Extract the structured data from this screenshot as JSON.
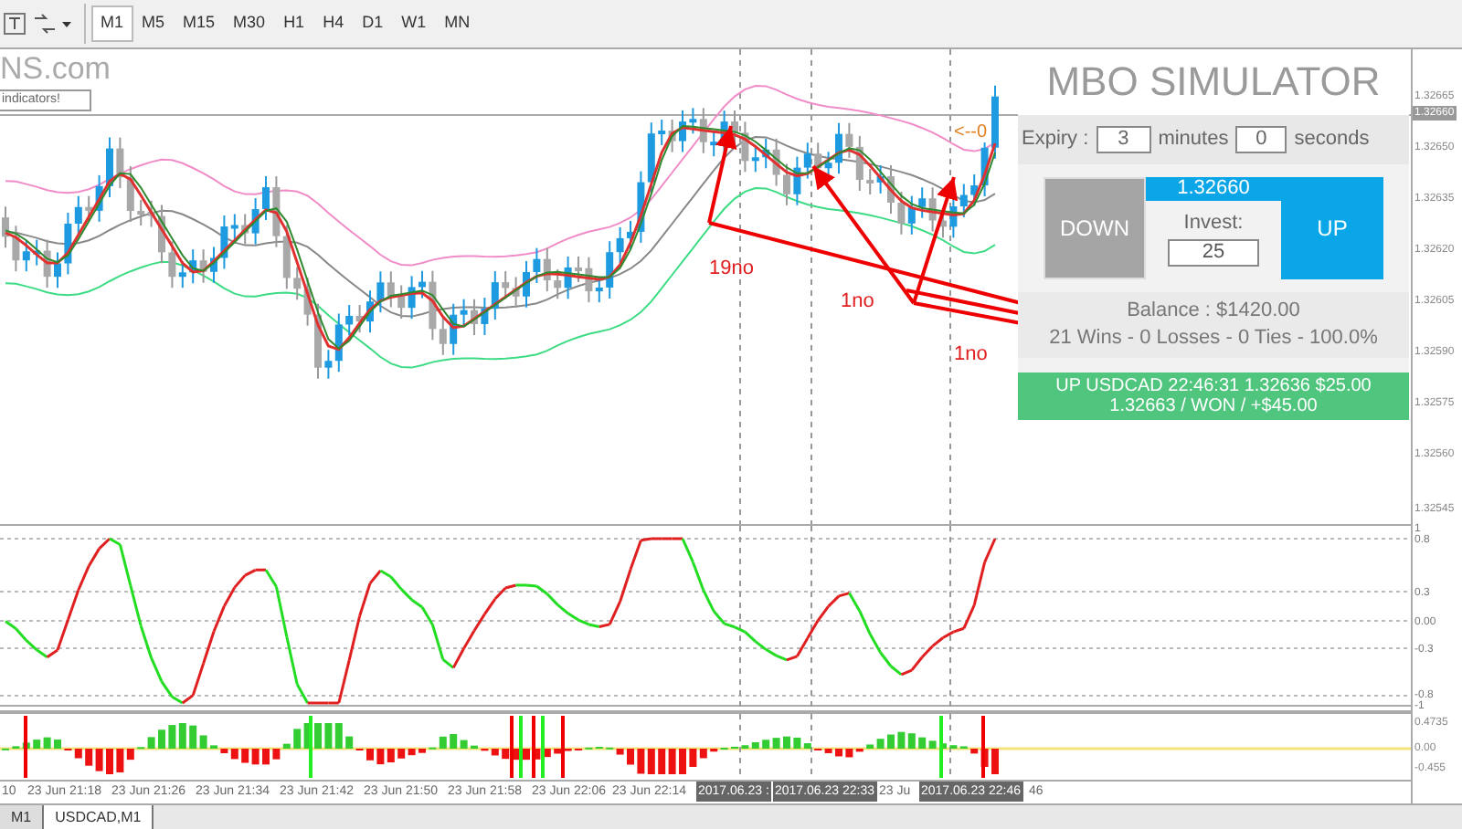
{
  "toolbar": {
    "timeframes": [
      {
        "label": "M1",
        "selected": true
      },
      {
        "label": "M5",
        "selected": false
      },
      {
        "label": "M15",
        "selected": false
      },
      {
        "label": "M30",
        "selected": false
      },
      {
        "label": "H1",
        "selected": false
      },
      {
        "label": "H4",
        "selected": false
      },
      {
        "label": "D1",
        "selected": false
      },
      {
        "label": "W1",
        "selected": false
      },
      {
        "label": "MN",
        "selected": false
      }
    ]
  },
  "chart": {
    "logo_text": "NS.com",
    "banner_text": "indicators!",
    "price_tag": "<--0",
    "annotations": [
      {
        "text": "19no"
      },
      {
        "text": "1no"
      },
      {
        "text": "1no"
      }
    ],
    "price_axis": [
      {
        "label": "1.32665",
        "current": false
      },
      {
        "label": "1.32660",
        "current": true
      },
      {
        "label": "1.32650",
        "current": false
      },
      {
        "label": "1.32635",
        "current": false
      },
      {
        "label": "1.32620",
        "current": false
      },
      {
        "label": "1.32605",
        "current": false
      },
      {
        "label": "1.32590",
        "current": false
      },
      {
        "label": "1.32575",
        "current": false
      },
      {
        "label": "1.32560",
        "current": false
      },
      {
        "label": "1.32545",
        "current": false
      }
    ]
  },
  "simulator": {
    "title": "MBO SIMULATOR",
    "expiry_label": "Expiry :",
    "minutes": "3",
    "minutes_label": "minutes",
    "seconds": "0",
    "seconds_label": "seconds",
    "down_label": "DOWN",
    "price": "1.32660",
    "invest_label": "Invest:",
    "invest": "25",
    "up_label": "UP",
    "balance": "Balance : $1420.00",
    "stats": "21 Wins - 0 Losses - 0 Ties - 100.0%",
    "result_lines": [
      "UP USDCAD 22:46:31 1.32636 $25.00",
      "1.32663 / WON / +$45.00"
    ]
  },
  "oscillator": {
    "axis": [
      "1",
      "0.8",
      "0.3",
      "0.00",
      "-0.3",
      "-0.8",
      "-1"
    ]
  },
  "histogram": {
    "axis": [
      "0.4735",
      "0.00",
      "-0.455"
    ]
  },
  "time_axis": [
    {
      "label": "10",
      "highlighted": false
    },
    {
      "label": "23 Jun 21:18",
      "highlighted": false
    },
    {
      "label": "23 Jun 21:26",
      "highlighted": false
    },
    {
      "label": "23 Jun 21:34",
      "highlighted": false
    },
    {
      "label": "23 Jun 21:42",
      "highlighted": false
    },
    {
      "label": "23 Jun 21:50",
      "highlighted": false
    },
    {
      "label": "23 Jun 21:58",
      "highlighted": false
    },
    {
      "label": "23 Jun 22:06",
      "highlighted": false
    },
    {
      "label": "23 Jun 22:14",
      "highlighted": false
    },
    {
      "label": "2017.06.23 :",
      "highlighted": true
    },
    {
      "label": "2017.06.23 22:33",
      "highlighted": true
    },
    {
      "label": "23 Ju",
      "highlighted": false
    },
    {
      "label": "2017.06.23 22:46",
      "highlighted": true
    },
    {
      "label": "46",
      "highlighted": false
    }
  ],
  "tabs": [
    {
      "label": "M1",
      "selected": false
    },
    {
      "label": "USDCAD,M1",
      "selected": true
    }
  ]
}
